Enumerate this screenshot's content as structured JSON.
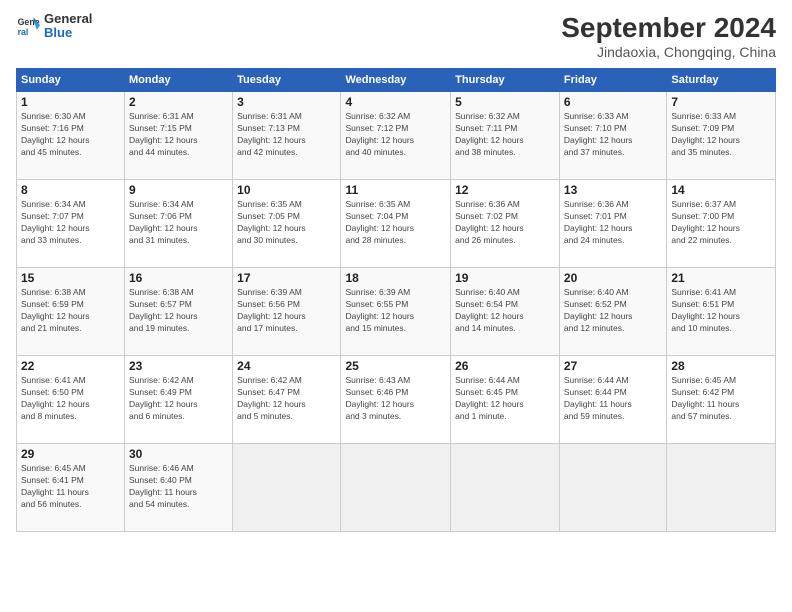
{
  "header": {
    "logo_line1": "General",
    "logo_line2": "Blue",
    "month": "September 2024",
    "location": "Jindaoxia, Chongqing, China"
  },
  "weekdays": [
    "Sunday",
    "Monday",
    "Tuesday",
    "Wednesday",
    "Thursday",
    "Friday",
    "Saturday"
  ],
  "weeks": [
    [
      {
        "day": "1",
        "info": "Sunrise: 6:30 AM\nSunset: 7:16 PM\nDaylight: 12 hours\nand 45 minutes."
      },
      {
        "day": "2",
        "info": "Sunrise: 6:31 AM\nSunset: 7:15 PM\nDaylight: 12 hours\nand 44 minutes."
      },
      {
        "day": "3",
        "info": "Sunrise: 6:31 AM\nSunset: 7:13 PM\nDaylight: 12 hours\nand 42 minutes."
      },
      {
        "day": "4",
        "info": "Sunrise: 6:32 AM\nSunset: 7:12 PM\nDaylight: 12 hours\nand 40 minutes."
      },
      {
        "day": "5",
        "info": "Sunrise: 6:32 AM\nSunset: 7:11 PM\nDaylight: 12 hours\nand 38 minutes."
      },
      {
        "day": "6",
        "info": "Sunrise: 6:33 AM\nSunset: 7:10 PM\nDaylight: 12 hours\nand 37 minutes."
      },
      {
        "day": "7",
        "info": "Sunrise: 6:33 AM\nSunset: 7:09 PM\nDaylight: 12 hours\nand 35 minutes."
      }
    ],
    [
      {
        "day": "8",
        "info": "Sunrise: 6:34 AM\nSunset: 7:07 PM\nDaylight: 12 hours\nand 33 minutes."
      },
      {
        "day": "9",
        "info": "Sunrise: 6:34 AM\nSunset: 7:06 PM\nDaylight: 12 hours\nand 31 minutes."
      },
      {
        "day": "10",
        "info": "Sunrise: 6:35 AM\nSunset: 7:05 PM\nDaylight: 12 hours\nand 30 minutes."
      },
      {
        "day": "11",
        "info": "Sunrise: 6:35 AM\nSunset: 7:04 PM\nDaylight: 12 hours\nand 28 minutes."
      },
      {
        "day": "12",
        "info": "Sunrise: 6:36 AM\nSunset: 7:02 PM\nDaylight: 12 hours\nand 26 minutes."
      },
      {
        "day": "13",
        "info": "Sunrise: 6:36 AM\nSunset: 7:01 PM\nDaylight: 12 hours\nand 24 minutes."
      },
      {
        "day": "14",
        "info": "Sunrise: 6:37 AM\nSunset: 7:00 PM\nDaylight: 12 hours\nand 22 minutes."
      }
    ],
    [
      {
        "day": "15",
        "info": "Sunrise: 6:38 AM\nSunset: 6:59 PM\nDaylight: 12 hours\nand 21 minutes."
      },
      {
        "day": "16",
        "info": "Sunrise: 6:38 AM\nSunset: 6:57 PM\nDaylight: 12 hours\nand 19 minutes."
      },
      {
        "day": "17",
        "info": "Sunrise: 6:39 AM\nSunset: 6:56 PM\nDaylight: 12 hours\nand 17 minutes."
      },
      {
        "day": "18",
        "info": "Sunrise: 6:39 AM\nSunset: 6:55 PM\nDaylight: 12 hours\nand 15 minutes."
      },
      {
        "day": "19",
        "info": "Sunrise: 6:40 AM\nSunset: 6:54 PM\nDaylight: 12 hours\nand 14 minutes."
      },
      {
        "day": "20",
        "info": "Sunrise: 6:40 AM\nSunset: 6:52 PM\nDaylight: 12 hours\nand 12 minutes."
      },
      {
        "day": "21",
        "info": "Sunrise: 6:41 AM\nSunset: 6:51 PM\nDaylight: 12 hours\nand 10 minutes."
      }
    ],
    [
      {
        "day": "22",
        "info": "Sunrise: 6:41 AM\nSunset: 6:50 PM\nDaylight: 12 hours\nand 8 minutes."
      },
      {
        "day": "23",
        "info": "Sunrise: 6:42 AM\nSunset: 6:49 PM\nDaylight: 12 hours\nand 6 minutes."
      },
      {
        "day": "24",
        "info": "Sunrise: 6:42 AM\nSunset: 6:47 PM\nDaylight: 12 hours\nand 5 minutes."
      },
      {
        "day": "25",
        "info": "Sunrise: 6:43 AM\nSunset: 6:46 PM\nDaylight: 12 hours\nand 3 minutes."
      },
      {
        "day": "26",
        "info": "Sunrise: 6:44 AM\nSunset: 6:45 PM\nDaylight: 12 hours\nand 1 minute."
      },
      {
        "day": "27",
        "info": "Sunrise: 6:44 AM\nSunset: 6:44 PM\nDaylight: 11 hours\nand 59 minutes."
      },
      {
        "day": "28",
        "info": "Sunrise: 6:45 AM\nSunset: 6:42 PM\nDaylight: 11 hours\nand 57 minutes."
      }
    ],
    [
      {
        "day": "29",
        "info": "Sunrise: 6:45 AM\nSunset: 6:41 PM\nDaylight: 11 hours\nand 56 minutes."
      },
      {
        "day": "30",
        "info": "Sunrise: 6:46 AM\nSunset: 6:40 PM\nDaylight: 11 hours\nand 54 minutes."
      },
      {
        "day": "",
        "info": ""
      },
      {
        "day": "",
        "info": ""
      },
      {
        "day": "",
        "info": ""
      },
      {
        "day": "",
        "info": ""
      },
      {
        "day": "",
        "info": ""
      }
    ]
  ]
}
